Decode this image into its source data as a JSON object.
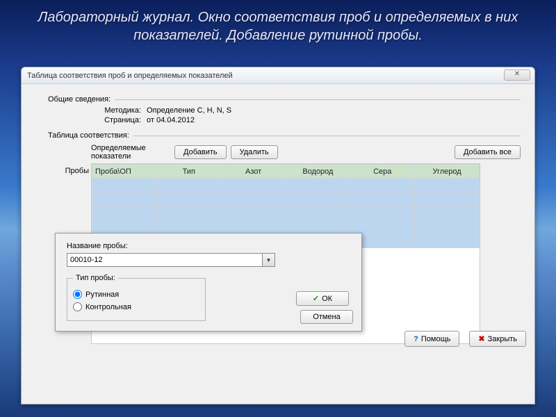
{
  "slide": {
    "title_em": "Лабораторный журнал.",
    "title_rest": " Окно соответствия проб и определяемых в них показателей. Добавление рутинной пробы."
  },
  "window": {
    "title": "Таблица соответствия проб и определяемых показателей",
    "close_glyph": "✕"
  },
  "sections": {
    "general": "Общие сведения:",
    "method_k": "Методика:",
    "method_v": "Определение C, H, N, S",
    "page_k": "Страница:",
    "page_v": "от 04.04.2012",
    "correspond": "Таблица соответствия:"
  },
  "toolbar": {
    "col_label": "Определяемые показатели",
    "add": "Добавить",
    "del": "Удалить",
    "add_all": "Добавить все",
    "row_label": "Пробы"
  },
  "table": {
    "headers": [
      "Проба\\ОП",
      "Тип",
      "Азот",
      "Водород",
      "Сера",
      "Углерод"
    ]
  },
  "dialog": {
    "name_label": "Название пробы:",
    "name_value": "00010-12",
    "type_legend": "Тип пробы:",
    "radio_routine": "Рутинная",
    "radio_control": "Контрольная",
    "ok": "ОК",
    "cancel": "Отмена"
  },
  "footer": {
    "help": "Помощь",
    "close": "Закрыть"
  }
}
